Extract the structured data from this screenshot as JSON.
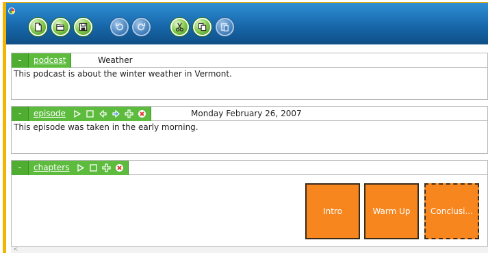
{
  "toolbar": {
    "buttons": [
      {
        "name": "new-document-icon",
        "enabled": true
      },
      {
        "name": "open-folder-icon",
        "enabled": true
      },
      {
        "name": "save-icon",
        "enabled": true
      },
      {
        "name": "undo-icon",
        "enabled": false
      },
      {
        "name": "redo-icon",
        "enabled": false
      },
      {
        "name": "cut-icon",
        "enabled": true
      },
      {
        "name": "copy-icon",
        "enabled": true
      },
      {
        "name": "paste-icon",
        "enabled": false
      }
    ]
  },
  "podcast": {
    "tag_label": "podcast",
    "title": "Weather",
    "description": "This podcast is about the winter weather in Vermont."
  },
  "episode": {
    "tag_label": "episode",
    "date": "Monday February 26, 2007",
    "description": "This episode was taken in the early morning.",
    "icons": [
      "play-icon",
      "stop-icon",
      "move-left-icon",
      "move-right-icon",
      "add-icon",
      "delete-icon"
    ]
  },
  "chapters": {
    "tag_label": "chapters",
    "icons": [
      "play-icon",
      "stop-icon",
      "add-icon",
      "delete-icon"
    ],
    "items": [
      {
        "label": "Intro",
        "selected": false
      },
      {
        "label": "Warm Up",
        "selected": false
      },
      {
        "label": "Conclusi...",
        "selected": true
      }
    ]
  },
  "collapse_symbol": "-",
  "colors": {
    "toolbar_blue": "#1768ab",
    "frame_gold": "#f5b400",
    "tag_green": "#5dbb3e",
    "chapter_orange": "#f7861f"
  }
}
